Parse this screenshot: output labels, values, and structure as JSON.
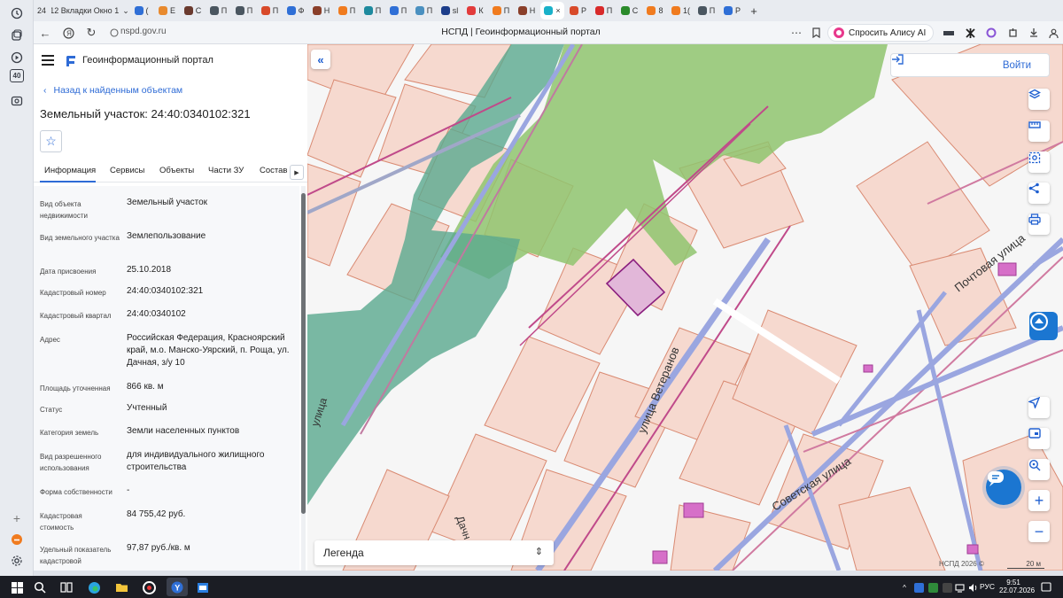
{
  "browser": {
    "tabs": [
      {
        "label": "24",
        "color": "#e8ebf0"
      },
      {
        "label": "12 Вкладки Окно 1",
        "color": "#e8ebf0"
      },
      {
        "label": "(",
        "color": "#2f6fd6"
      },
      {
        "label": "E",
        "color": "#e88a2e"
      },
      {
        "label": "С",
        "color": "#6a3a2e"
      },
      {
        "label": "П",
        "color": "#4a5660"
      },
      {
        "label": "П",
        "color": "#4a5660"
      },
      {
        "label": "П",
        "color": "#d84a2a"
      },
      {
        "label": "Ф",
        "color": "#2f6fd6"
      },
      {
        "label": "Н",
        "color": "#8a3f2a"
      },
      {
        "label": "П",
        "color": "#f07b1f"
      },
      {
        "label": "П",
        "color": "#1e8a9e"
      },
      {
        "label": "П",
        "color": "#2f6fd6"
      },
      {
        "label": "П",
        "color": "#4a90c0"
      },
      {
        "label": "sl",
        "color": "#1c3d8a"
      },
      {
        "label": "К",
        "color": "#e23b3b"
      },
      {
        "label": "П",
        "color": "#f07b1f"
      },
      {
        "label": "Н",
        "color": "#8a3f2a"
      },
      {
        "label": "×",
        "color": "#19b1c9",
        "active": true
      },
      {
        "label": "Р",
        "color": "#d84a2a"
      },
      {
        "label": "П",
        "color": "#d82a2a"
      },
      {
        "label": "С",
        "color": "#2a8a2a"
      },
      {
        "label": "8",
        "color": "#f07b1f"
      },
      {
        "label": "1(",
        "color": "#f07b1f"
      },
      {
        "label": "П",
        "color": "#4a5660"
      },
      {
        "label": "Р",
        "color": "#2f6fd6"
      }
    ],
    "new_tab": "+",
    "url": "nspd.gov.ru",
    "page_title": "НСПД | Геоинформационный портал",
    "alice_label": "Спросить Алису AI",
    "left_strip_badge": "40"
  },
  "panel": {
    "portal_name": "Геоинформационный портал",
    "back_label": "Назад к найденным объектам",
    "title": "Земельный участок: 24:40:0340102:321",
    "tabs": [
      "Информация",
      "Сервисы",
      "Объекты",
      "Части ЗУ",
      "Состав"
    ],
    "properties": [
      {
        "label": "Вид объекта недвижимости",
        "value": "Земельный участок"
      },
      {
        "label": "Вид земельного участка",
        "value": "Землепользование"
      },
      {
        "label": "Дата присвоения",
        "value": "25.10.2018"
      },
      {
        "label": "Кадастровый номер",
        "value": "24:40:0340102:321"
      },
      {
        "label": "Кадастровый квартал",
        "value": "24:40:0340102"
      },
      {
        "label": "Адрес",
        "value": "Российская Федерация, Красноярский край, м.о. Манско-Уярский, п. Роща, ул. Дачная, з/у 10"
      },
      {
        "label": "Площадь уточненная",
        "value": "866 кв. м"
      },
      {
        "label": "Статус",
        "value": "Учтенный"
      },
      {
        "label": "Категория земель",
        "value": "Земли населенных пунктов"
      },
      {
        "label": "Вид разрешенного использования",
        "value": "для индивидуального жилищного строительства"
      },
      {
        "label": "Форма собственности",
        "value": "-"
      },
      {
        "label": "Кадастровая стоимость",
        "value": "84 755,42 руб."
      },
      {
        "label": "Удельный показатель кадастровой",
        "value": "97,87 руб./кв. м"
      }
    ]
  },
  "map": {
    "login_label": "Войти",
    "legend_label": "Легенда",
    "copyright": "НСПД 2026 ©",
    "scale": "20 м",
    "streets": [
      {
        "name": "улица Ветеранов"
      },
      {
        "name": "Почтовая улица"
      },
      {
        "name": "Советская улица"
      },
      {
        "name": "улица"
      },
      {
        "name": "Дачн"
      }
    ],
    "colors": {
      "parcel_fill": "#f6d9cf",
      "parcel_stroke": "#d98a72",
      "forest": "#8fc46e",
      "water": "#5aa98f",
      "selected_fill": "#e2b7d9",
      "selected_stroke": "#8a1e7e",
      "road": "#9aa6e0",
      "accent": "#1b76d1"
    }
  },
  "taskbar": {
    "lang": "РУС",
    "time": "9:51",
    "date": "22.07.2026"
  }
}
